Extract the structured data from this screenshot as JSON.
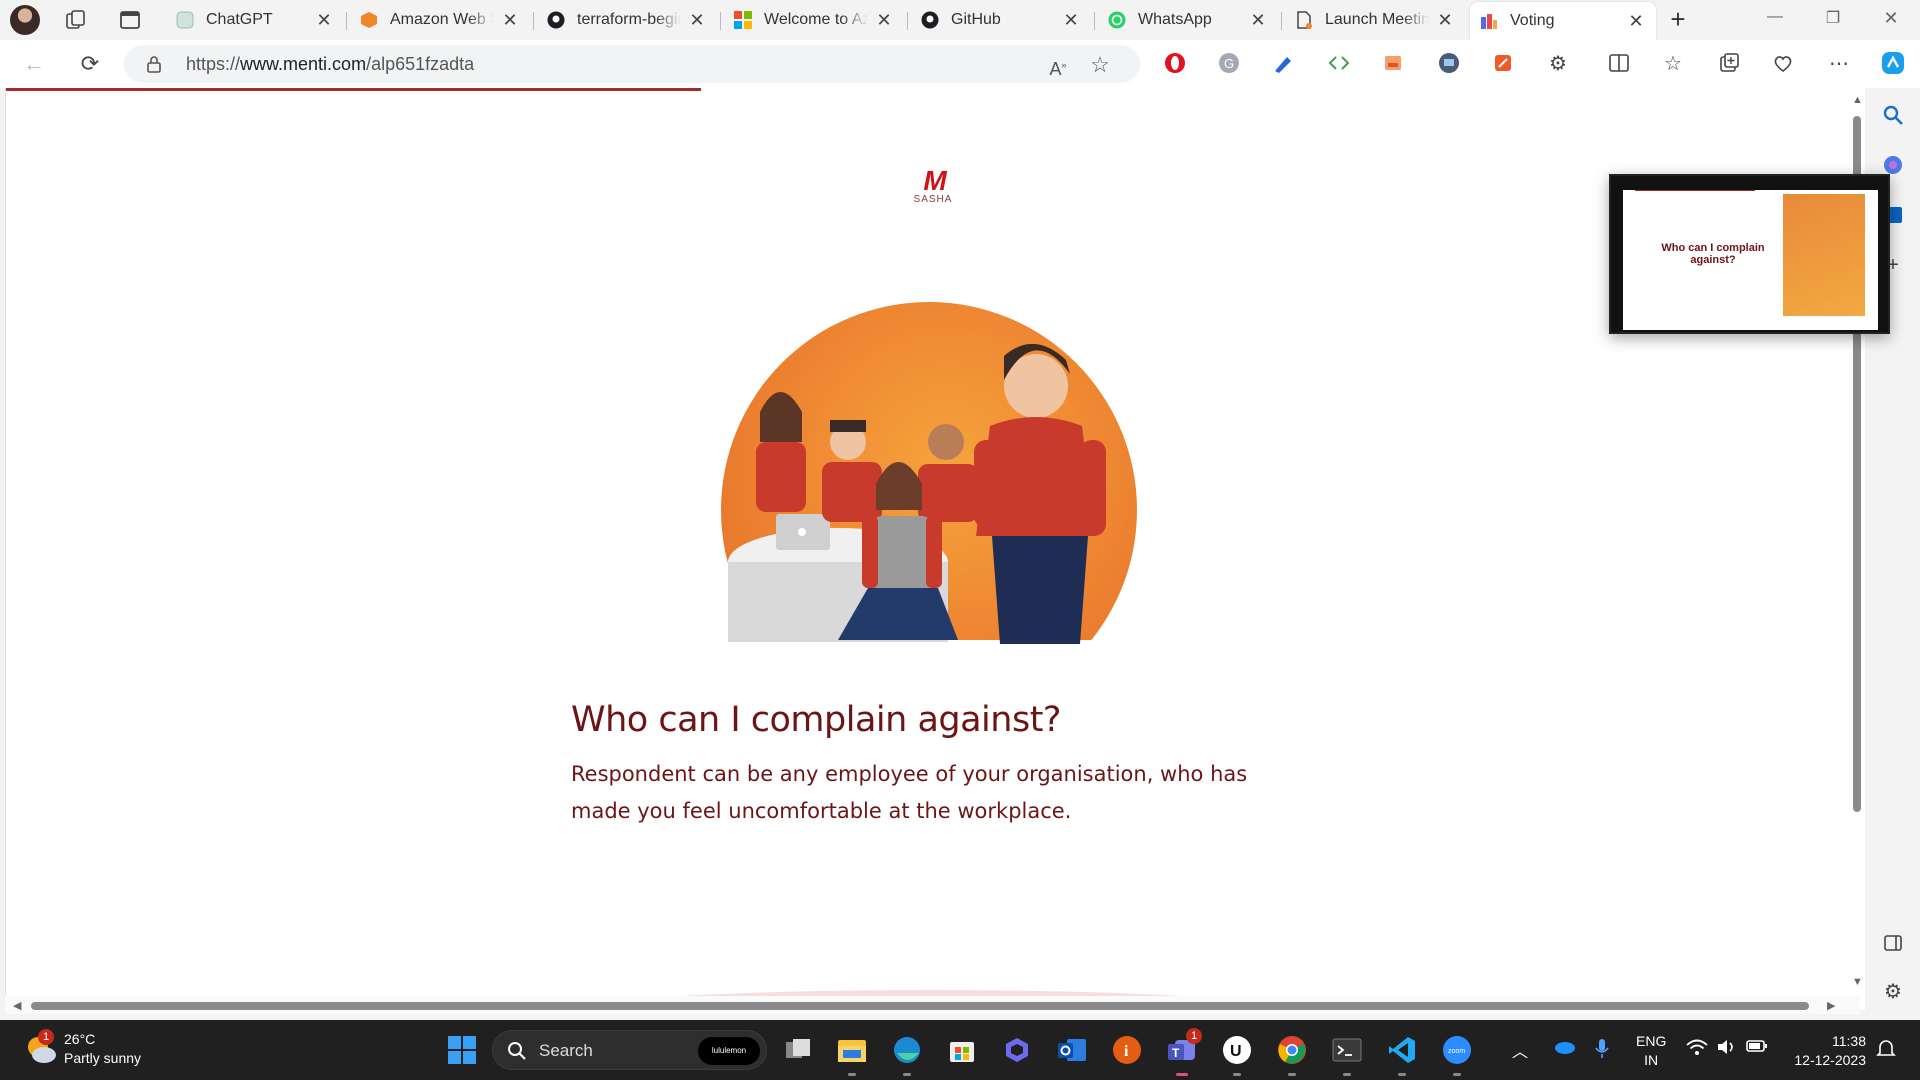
{
  "tabs": [
    {
      "title": "ChatGPT",
      "icon": "chatgpt-icon"
    },
    {
      "title": "Amazon Web Se",
      "icon": "aws-icon"
    },
    {
      "title": "terraform-begin",
      "icon": "github-icon"
    },
    {
      "title": "Welcome to Azu",
      "icon": "microsoft-icon"
    },
    {
      "title": "GitHub",
      "icon": "github-icon"
    },
    {
      "title": "WhatsApp",
      "icon": "whatsapp-icon"
    },
    {
      "title": "Launch Meeting",
      "icon": "document-icon"
    },
    {
      "title": "Voting",
      "icon": "mentimeter-icon",
      "active": true
    }
  ],
  "tab_close": "✕",
  "new_tab": "+",
  "address": {
    "scheme": "https://",
    "host": "www.menti.com",
    "path": "/alp651fzadta"
  },
  "page": {
    "logo_mark": "M",
    "logo_sub": "SASHA",
    "question": "Who can I complain against?",
    "description": "Respondent can be any employee of your organisation, who has made you feel uncomfortable at the workplace.",
    "accent": "#6d1515"
  },
  "preview": {
    "title": "Who can I complain against?"
  },
  "taskbar": {
    "weather_temp": "26°C",
    "weather_desc": "Partly sunny",
    "weather_badge": "1",
    "search_label": "Search",
    "search_pill": "lululemon",
    "teams_badge": "1",
    "lang_line1": "ENG",
    "lang_line2": "IN",
    "time": "11:38",
    "date": "12-12-2023"
  }
}
